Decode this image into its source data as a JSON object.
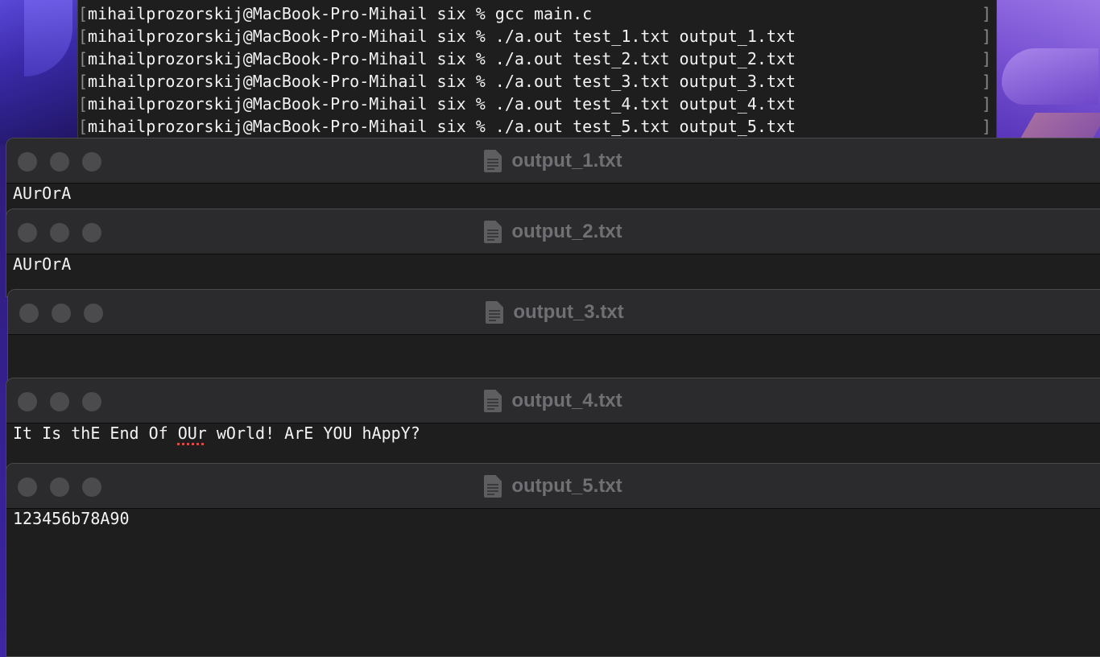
{
  "terminal": {
    "lines": [
      {
        "prompt": "mihailprozorskij@MacBook-Pro-Mihail six % ",
        "command": "gcc main.c"
      },
      {
        "prompt": "mihailprozorskij@MacBook-Pro-Mihail six % ",
        "command": "./a.out test_1.txt output_1.txt"
      },
      {
        "prompt": "mihailprozorskij@MacBook-Pro-Mihail six % ",
        "command": "./a.out test_2.txt output_2.txt"
      },
      {
        "prompt": "mihailprozorskij@MacBook-Pro-Mihail six % ",
        "command": "./a.out test_3.txt output_3.txt"
      },
      {
        "prompt": "mihailprozorskij@MacBook-Pro-Mihail six % ",
        "command": "./a.out test_4.txt output_4.txt"
      },
      {
        "prompt": "mihailprozorskij@MacBook-Pro-Mihail six % ",
        "command": "./a.out test_5.txt output_5.txt"
      }
    ],
    "bracket_left": "[",
    "bracket_right": "]"
  },
  "windows": [
    {
      "title": "output_1.txt",
      "content": "AUrOrA"
    },
    {
      "title": "output_2.txt",
      "content": "AUrOrA"
    },
    {
      "title": "output_3.txt",
      "content": ""
    },
    {
      "title": "output_4.txt",
      "content_pre": "It Is thE End Of ",
      "content_misspelled": "OUr",
      "content_post": " wOrld! ArE YOU hAppY?"
    },
    {
      "title": "output_5.txt",
      "content": "123456b78A90"
    }
  ],
  "colors": {
    "terminal_bg": "#1e1e1e",
    "editor_bg": "#1e1e1e",
    "titlebar_bg": "#2b2b2e",
    "title_text": "#707074",
    "traffic_light_inactive": "#4b4b4e",
    "spellcheck_underline": "#d94b4b"
  },
  "icons": {
    "window_title_icon": "document-icon",
    "traffic_lights": [
      "close-icon",
      "minimize-icon",
      "zoom-icon"
    ]
  }
}
